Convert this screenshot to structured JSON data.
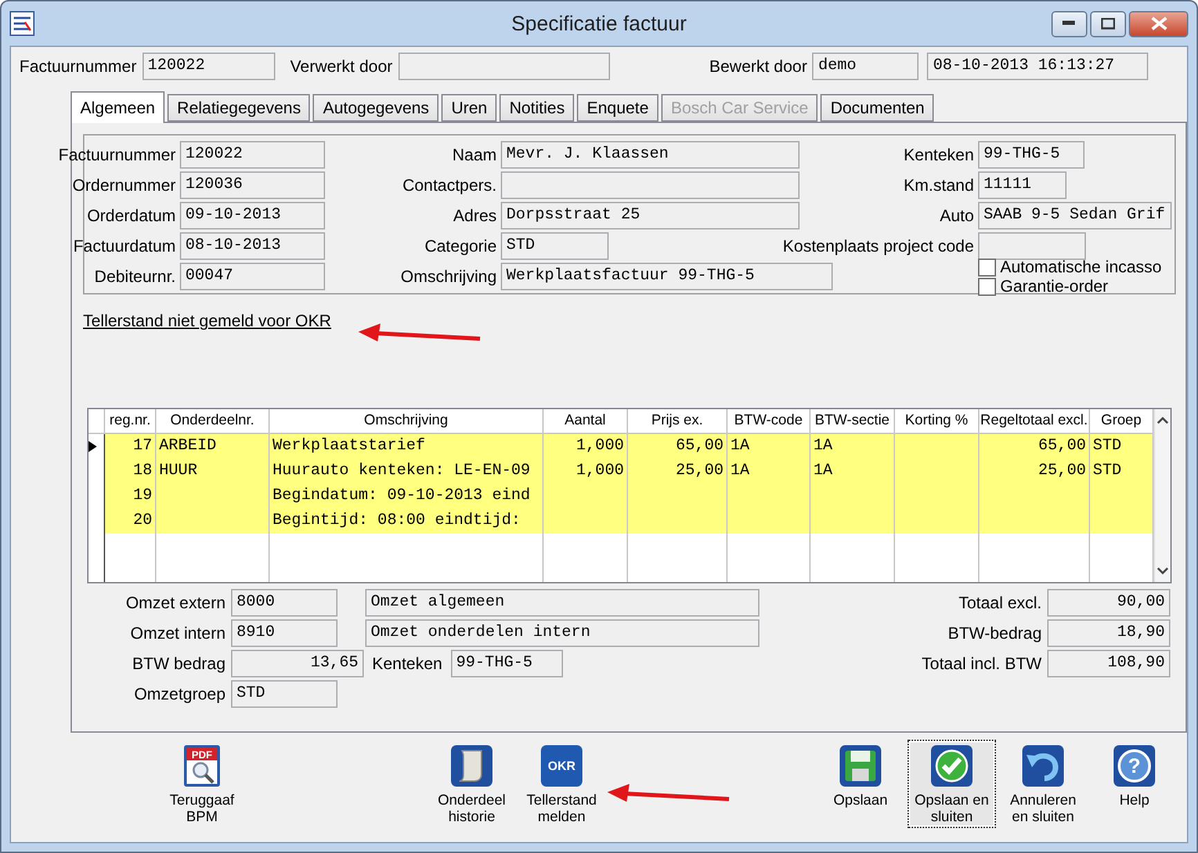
{
  "window": {
    "title": "Specificatie factuur"
  },
  "header": [
    {
      "label": "Factuurnummer",
      "value": "120022"
    },
    {
      "label": "Verwerkt door"
    },
    {
      "label": "Bewerkt door",
      "value": "demo"
    },
    {
      "value": "08-10-2013 16:13:27"
    }
  ],
  "tabs": [
    {
      "label": "Algemeen",
      "selected": true,
      "disabled": false
    },
    {
      "label": "Relatiegegevens",
      "selected": false,
      "disabled": false
    },
    {
      "label": "Autogegevens",
      "selected": false,
      "disabled": false
    },
    {
      "label": "Uren",
      "selected": false,
      "disabled": false
    },
    {
      "label": "Notities",
      "selected": false,
      "disabled": false
    },
    {
      "label": "Enquete",
      "selected": false,
      "disabled": false
    },
    {
      "label": "Bosch Car Service",
      "selected": false,
      "disabled": true
    },
    {
      "label": "Documenten",
      "selected": false,
      "disabled": false
    }
  ],
  "general": {
    "rows": [
      [
        {
          "label": "Factuurnummer",
          "value": "120022"
        },
        {
          "label": "Naam",
          "value": "Mevr. J. Klaassen"
        },
        {
          "label": "Kenteken",
          "value": "99-THG-5"
        }
      ],
      [
        {
          "label": "Ordernummer",
          "value": "120036"
        },
        {
          "label": "Contactpers."
        },
        {
          "label": "Km.stand",
          "value": "11111"
        }
      ],
      [
        {
          "label": "Orderdatum",
          "value": "09-10-2013"
        },
        {
          "label": "Adres",
          "value": "Dorpsstraat 25"
        },
        {
          "label": "Auto",
          "value": "SAAB 9-5 Sedan Grif"
        }
      ],
      [
        {
          "label": "Factuurdatum",
          "value": "08-10-2013"
        },
        {
          "label": "Categorie",
          "value": "STD"
        },
        {
          "label": "Kostenplaats project code"
        }
      ],
      [
        {
          "label": "Debiteurnr.",
          "value": "00047"
        },
        {
          "label": "Omschrijving",
          "value": "Werkplaatsfactuur 99-THG-5"
        }
      ]
    ],
    "checkboxes": [
      {
        "label": "Automatische incasso",
        "checked": false
      },
      {
        "label": "Garantie-order",
        "checked": false
      }
    ]
  },
  "notice_link": "Tellerstand niet gemeld voor OKR",
  "table": {
    "columns": [
      "reg.nr.",
      "Onderdeelnr.",
      "Omschrijving",
      "Aantal",
      "Prijs ex.",
      "BTW-code",
      "BTW-sectie",
      "Korting %",
      "Regeltotaal excl.",
      "Groep"
    ],
    "rows": [
      {
        "current": true,
        "highlighted": true,
        "cells": [
          "17",
          "ARBEID",
          "Werkplaatstarief",
          "1,000",
          "65,00",
          "1A",
          "1A",
          null,
          "65,00",
          "STD"
        ]
      },
      {
        "current": false,
        "highlighted": true,
        "cells": [
          "18",
          "HUUR",
          "Huurauto kenteken: LE-EN-09",
          "1,000",
          "25,00",
          "1A",
          "1A",
          null,
          "25,00",
          "STD"
        ]
      },
      {
        "current": false,
        "highlighted": true,
        "cells": [
          "19",
          null,
          "Begindatum: 09-10-2013 eind",
          null,
          null,
          null,
          null,
          null,
          null,
          null
        ]
      },
      {
        "current": false,
        "highlighted": true,
        "cells": [
          "20",
          null,
          "Begintijd: 08:00 eindtijd:",
          null,
          null,
          null,
          null,
          null,
          null,
          null
        ]
      }
    ]
  },
  "revenue": {
    "omzet_extern": {
      "label": "Omzet extern",
      "code": "8000",
      "description": "Omzet algemeen"
    },
    "omzet_intern": {
      "label": "Omzet intern",
      "code": "8910",
      "description": "Omzet onderdelen intern"
    },
    "btw_bedrag": {
      "label": "BTW bedrag",
      "value": "13,65"
    },
    "kenteken": {
      "label": "Kenteken",
      "value": "99-THG-5"
    },
    "omzetgroep": {
      "label": "Omzetgroep",
      "value": "STD"
    }
  },
  "totals": [
    {
      "label": "Totaal excl.",
      "value": "90,00"
    },
    {
      "label": "BTW-bedrag",
      "value": "18,90"
    },
    {
      "label": "Totaal incl. BTW",
      "value": "108,90"
    }
  ],
  "toolbar": {
    "left": [
      {
        "label": "Teruggaaf BPM",
        "kind": "pdf",
        "icon_text": "PDF",
        "focused": false
      }
    ],
    "middle": [
      {
        "label": "Onderdeel historie",
        "kind": "scroll",
        "focused": false
      },
      {
        "label": "Tellerstand melden",
        "kind": "okr",
        "icon_text": "OKR",
        "focused": false
      }
    ],
    "right": [
      {
        "label": "Opslaan",
        "kind": "save",
        "focused": false
      },
      {
        "label": "Opslaan en sluiten",
        "kind": "check",
        "focused": true
      },
      {
        "label": "Annuleren en sluiten",
        "kind": "undo",
        "focused": false
      },
      {
        "label": "Help",
        "kind": "help",
        "icon_text": "?",
        "focused": false
      }
    ]
  }
}
